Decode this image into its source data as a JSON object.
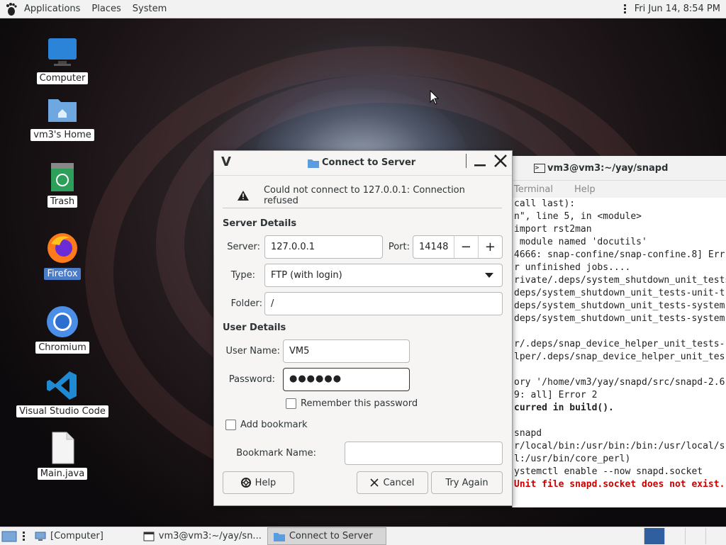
{
  "top_panel": {
    "menus": [
      "Applications",
      "Places",
      "System"
    ],
    "clock": "Fri Jun 14,  8:54 PM"
  },
  "desktop_icons": [
    {
      "label": "Computer",
      "icon": "monitor-icon"
    },
    {
      "label": "vm3's Home",
      "icon": "home-folder-icon"
    },
    {
      "label": "Trash",
      "icon": "trash-icon"
    },
    {
      "label": "Firefox",
      "icon": "firefox-icon",
      "selected": true
    },
    {
      "label": "Chromium",
      "icon": "chromium-icon"
    },
    {
      "label": "Visual Studio Code",
      "icon": "vscode-icon"
    },
    {
      "label": "Main.java",
      "icon": "file-icon"
    }
  ],
  "terminal": {
    "title": "vm3@vm3:~/yay/snapd",
    "menus": [
      "Terminal",
      "Help"
    ],
    "lines": [
      {
        "text": "call last):",
        "style": ""
      },
      {
        "text": "n\", line 5, in <module>",
        "style": ""
      },
      {
        "text": "import rst2man",
        "style": ""
      },
      {
        "text": " module named 'docutils'",
        "style": ""
      },
      {
        "text": "4666: snap-confine/snap-confine.8] Err",
        "style": ""
      },
      {
        "text": "r unfinished jobs....",
        "style": ""
      },
      {
        "text": "rivate/.deps/system_shutdown_unit_tests",
        "style": ""
      },
      {
        "text": "deps/system_shutdown_unit_tests-unit-t",
        "style": ""
      },
      {
        "text": "deps/system_shutdown_unit_tests-system",
        "style": ""
      },
      {
        "text": "deps/system_shutdown_unit_tests-system",
        "style": ""
      },
      {
        "text": "",
        "style": ""
      },
      {
        "text": "r/.deps/snap_device_helper_unit_tests-",
        "style": ""
      },
      {
        "text": "lper/.deps/snap_device_helper_unit_tes",
        "style": ""
      },
      {
        "text": "",
        "style": ""
      },
      {
        "text": "ory '/home/vm3/yay/snapd/src/snapd-2.6",
        "style": ""
      },
      {
        "text": "9: all] Error 2",
        "style": ""
      },
      {
        "text": "curred in build().",
        "style": "b"
      },
      {
        "text": "",
        "style": ""
      },
      {
        "text": "snapd",
        "style": ""
      },
      {
        "text": "r/local/bin:/usr/bin:/bin:/usr/local/s",
        "style": ""
      },
      {
        "text": "l:/usr/bin/core_perl)",
        "style": ""
      },
      {
        "text": "ystemctl enable --now snapd.socket",
        "style": ""
      },
      {
        "text": "Unit file snapd.socket does not exist.",
        "style": "red"
      }
    ]
  },
  "dialog": {
    "title": "Connect to Server",
    "error": "Could not connect to 127.0.0.1: Connection refused",
    "server_details": "Server Details",
    "server_label": "Server:",
    "server_value": "127.0.0.1",
    "port_label": "Port:",
    "port_value": "14148",
    "type_label": "Type:",
    "type_value": "FTP (with login)",
    "folder_label": "Folder:",
    "folder_value": "/",
    "user_details": "User Details",
    "username_label": "User Name:",
    "username_value": "VM5",
    "password_label": "Password:",
    "password_value": "●●●●●●",
    "remember_label": "Remember this password",
    "bookmark_label": "Add bookmark",
    "bookmark_name_label": "Bookmark Name:",
    "bookmark_name_value": "",
    "help": "Help",
    "cancel": "Cancel",
    "try_again": "Try Again"
  },
  "taskbar": {
    "tasks": [
      "[Computer]",
      "vm3@vm3:~/yay/sn...",
      "Connect to Server"
    ]
  }
}
